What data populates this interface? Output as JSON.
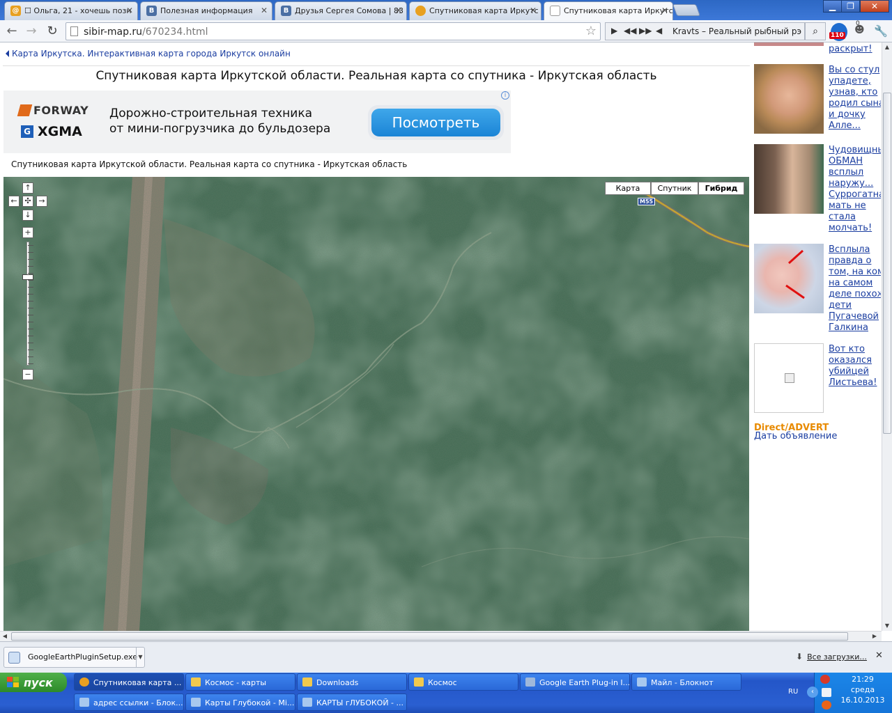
{
  "browser": {
    "tabs": [
      {
        "label": "☐ Ольга, 21 - хочешь позн",
        "icon": "mail-ru-icon",
        "color": "#e8a020"
      },
      {
        "label": "Полезная информация",
        "icon": "vk-icon",
        "color": "#4b6fa3"
      },
      {
        "label": "Друзья Сергея Сомова | 83",
        "icon": "vk-icon",
        "color": "#4b6fa3"
      },
      {
        "label": "Спутниковая карта Иркутс",
        "icon": "map-globe-icon",
        "color": "#e8a020"
      },
      {
        "label": "Спутниковая карта Иркутс",
        "icon": "page-icon",
        "color": "#ffffff"
      }
    ],
    "url_host": "sibir-map.ru",
    "url_path": "/670234.html",
    "player_text": "Kravts – Реальный рыбный рэп",
    "ext_badge": "110",
    "ext_count": "0"
  },
  "page": {
    "backlink": "Карта Иркутска. Интерактивная карта города Иркутск онлайн",
    "title": "Спутниковая карта Иркутской области. Реальная карта со спутника - Иркутская область",
    "subtitle": "Спутниковая карта Иркутской области. Реальная карта со спутника - Иркутская область",
    "ad": {
      "brand1": "FORWAY",
      "brand2": "XGMA",
      "line1": "Дорожно-строительная техника",
      "line2": "от мини-погрузчика до бульдозера",
      "button": "Посмотреть",
      "info": "i"
    }
  },
  "map": {
    "types": [
      "Карта",
      "Спутник",
      "Гибрид"
    ],
    "selected_type": "Гибрид",
    "road_label": "M55",
    "pan": {
      "up": "↑",
      "down": "↓",
      "left": "←",
      "right": "→",
      "center": "✣"
    },
    "zoom_in": "+",
    "zoom_out": "−"
  },
  "sidebar": {
    "links": [
      "раскрыт!",
      "Вы со стул\nупадете,\nузнав, кто\nродил сына\nи дочку\nАлле...",
      "Чудовищны\nОБМАН\nвсплыл\nнаружу...\nСуррогатна\nмать не\nстала\nмолчать!",
      "Всплыла\nправда о\nтом, на ком\nна самом\nделе похож\nдети\nПугачевой\nГалкина",
      "Вот кто\nоказался\nубийцей\nЛистьева!"
    ],
    "direct_label": "Direct/ADVERT",
    "direct_link": "Дать объявление"
  },
  "downloads": {
    "file": "GoogleEarthPluginSetup.exe",
    "all": "Все загрузки..."
  },
  "taskbar": {
    "start": "пуск",
    "tasks": [
      "Спутниковая карта ...",
      "Космос - карты",
      "Downloads",
      "Космос",
      "Google Earth Plug-in I...",
      "Майл - Блокнот",
      "адрес ссылки - Блок...",
      "Карты Глубокой - Mi...",
      "КАРТЫ гЛУБОКОЙ - ..."
    ],
    "lang": "RU",
    "time": "21:29",
    "day": "среда",
    "date": "16.10.2013"
  }
}
